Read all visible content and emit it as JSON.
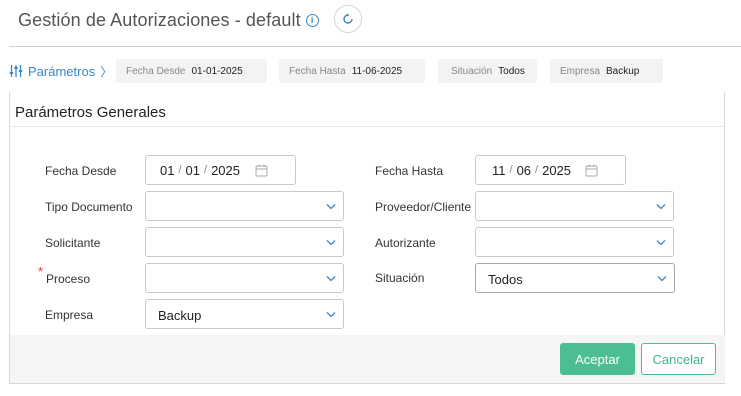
{
  "header": {
    "title": "Gestión de Autorizaciones - default"
  },
  "filterbar": {
    "toggle_label": "Parámetros",
    "chips": [
      {
        "label": "Fecha Desde",
        "value": "01-01-2025"
      },
      {
        "label": "Fecha Hasta",
        "value": "11-06-2025"
      },
      {
        "label": "Situación",
        "value": "Todos"
      },
      {
        "label": "Empresa",
        "value": "Backup"
      }
    ]
  },
  "panel": {
    "title": "Parámetros Generales",
    "fields": {
      "fecha_desde": {
        "label": "Fecha Desde",
        "day": "01",
        "month": "01",
        "year": "2025"
      },
      "fecha_hasta": {
        "label": "Fecha Hasta",
        "day": "11",
        "month": "06",
        "year": "2025"
      },
      "tipo_documento": {
        "label": "Tipo Documento",
        "value": ""
      },
      "proveedor_cliente": {
        "label": "Proveedor/Cliente",
        "value": ""
      },
      "solicitante": {
        "label": "Solicitante",
        "value": ""
      },
      "autorizante": {
        "label": "Autorizante",
        "value": ""
      },
      "proceso": {
        "label": "Proceso",
        "required_mark": "*",
        "value": ""
      },
      "situacion": {
        "label": "Situación",
        "value": "Todos"
      },
      "empresa": {
        "label": "Empresa",
        "value": "Backup"
      }
    },
    "actions": {
      "accept_label": "Aceptar",
      "cancel_label": "Cancelar"
    }
  },
  "colors": {
    "accent_blue": "#3a87c9",
    "accent_green": "#4bbf92",
    "required_red": "#e03b3b"
  }
}
